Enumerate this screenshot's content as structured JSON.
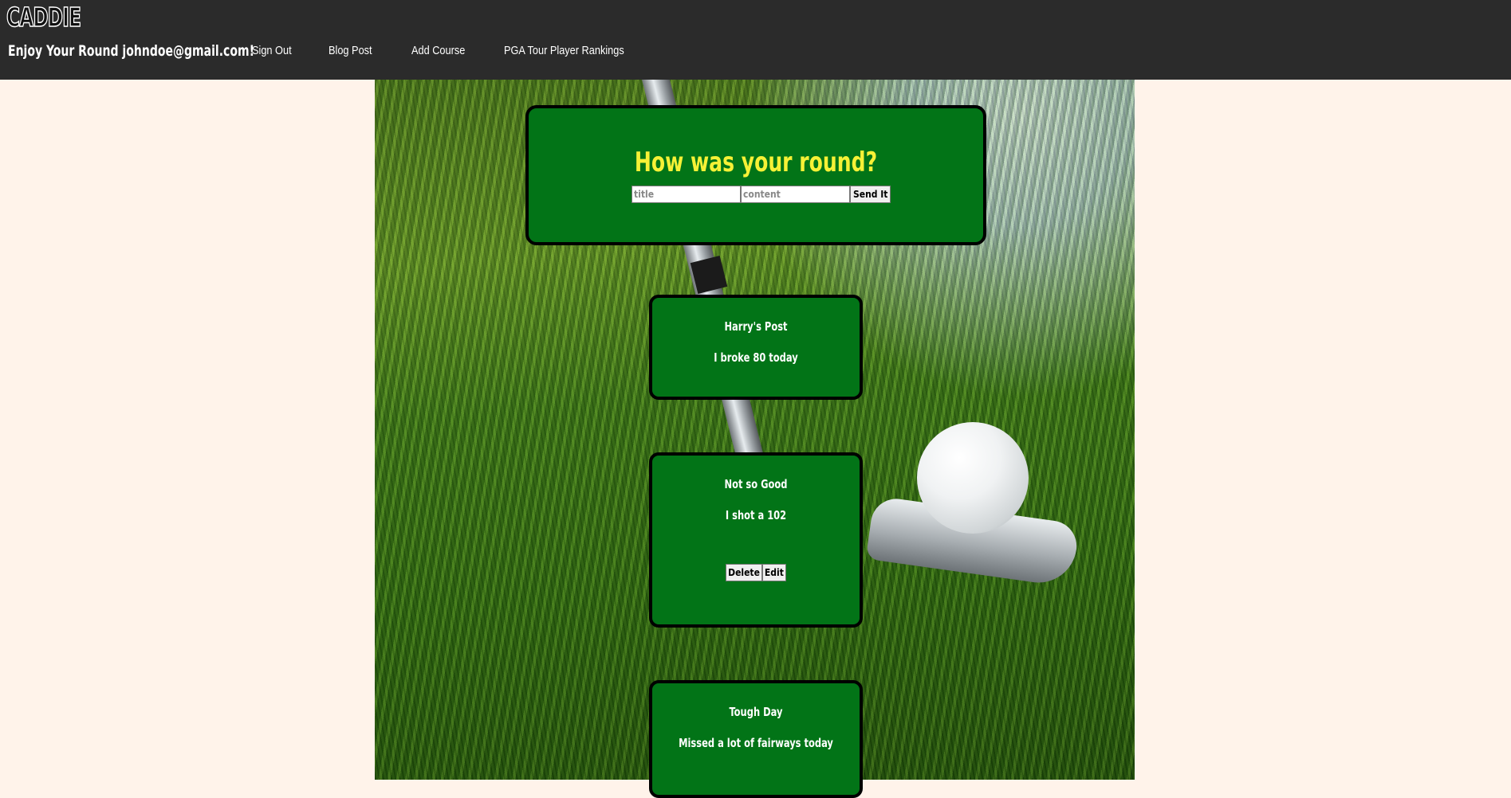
{
  "header": {
    "logo": "CADDIE",
    "greeting": "Enjoy Your Round johndoe@gmail.com!",
    "nav": [
      {
        "label": "Sign Out"
      },
      {
        "label": "Blog Post"
      },
      {
        "label": "Add Course"
      },
      {
        "label": "PGA Tour Player Rankings"
      }
    ]
  },
  "form": {
    "heading": "How was your round?",
    "title_placeholder": "title",
    "content_placeholder": "content",
    "submit_label": "Send It"
  },
  "posts": [
    {
      "title": "Harry's Post",
      "content": "I broke 80 today"
    },
    {
      "title": "Not so Good",
      "content": "I shot a 102",
      "delete_label": "Delete",
      "edit_label": "Edit"
    },
    {
      "title": "Tough Day",
      "content": "Missed a lot of fairways today"
    }
  ],
  "colors": {
    "header_bg": "#2b2b2b",
    "page_bg": "#fff3ea",
    "card_bg": "#027417",
    "heading_yellow": "#f6f136"
  }
}
